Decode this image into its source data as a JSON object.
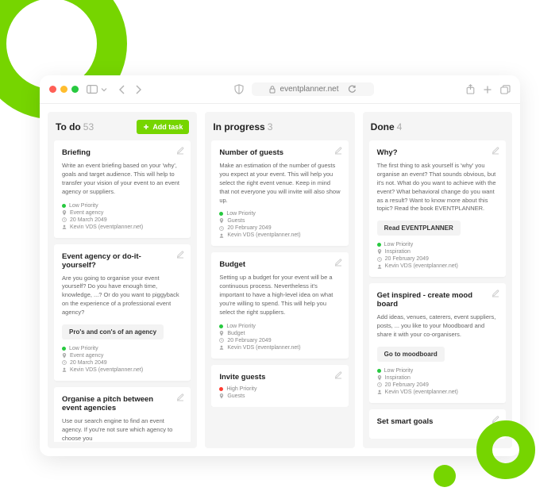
{
  "browser": {
    "url": "eventplanner.net"
  },
  "addTaskLabel": "Add task",
  "columns": [
    {
      "title": "To do",
      "count": 53,
      "showAdd": true,
      "cards": [
        {
          "title": "Briefing",
          "desc": "Write an event briefing based on your 'why', goals and target audience. This will help to transfer your vision of your event to an event agency or suppliers.",
          "priority": "Low Priority",
          "priClass": "pri-low",
          "category": "Event agency",
          "date": "20 March 2049",
          "assignee": "Kevin VDS (eventplanner.net)"
        },
        {
          "title": "Event agency or do-it-yourself?",
          "desc": "Are you going to organise your event yourself? Do you have enough time, knowledge, ...? Or do you want to piggyback on the experience of a professional event agency?",
          "button": "Pro's and con's of an agency",
          "priority": "Low Priority",
          "priClass": "pri-low",
          "category": "Event agency",
          "date": "20 March 2049",
          "assignee": "Kevin VDS (eventplanner.net)"
        },
        {
          "title": "Organise a pitch between event agencies",
          "desc": "Use our search engine to find an event agency. If you're not sure which agency to choose you"
        }
      ]
    },
    {
      "title": "In progress",
      "count": 3,
      "cards": [
        {
          "title": "Number of guests",
          "desc": "Make an estimation of the number of guests you expect at your event. This will help you select the right event venue. Keep in mind that not everyone you will invite will also show up.",
          "priority": "Low Priority",
          "priClass": "pri-low",
          "category": "Guests",
          "date": "20 February 2049",
          "assignee": "Kevin VDS (eventplanner.net)"
        },
        {
          "title": "Budget",
          "desc": "Setting up a budget for your event will be a continuous process. Nevertheless it's important to have a high-level idea on what you're willing to spend. This will help you select the right suppliers.",
          "priority": "Low Priority",
          "priClass": "pri-low",
          "category": "Budget",
          "date": "20 February 2049",
          "assignee": "Kevin VDS (eventplanner.net)"
        },
        {
          "title": "Invite guests",
          "priority": "High Priority",
          "priClass": "pri-high",
          "category": "Guests"
        }
      ]
    },
    {
      "title": "Done",
      "count": 4,
      "cards": [
        {
          "title": "Why?",
          "desc": "The first thing to ask yourself is 'why' you organise an event? That sounds obvious, but it's not. What do you want to achieve with the event? What behavioral change do you want as a result? Want to know more about this topic? Read the book EVENTPLANNER.",
          "button": "Read EVENTPLANNER",
          "priority": "Low Priority",
          "priClass": "pri-low",
          "category": "Inspiration",
          "date": "20 February 2049",
          "assignee": "Kevin VDS (eventplanner.net)"
        },
        {
          "title": "Get inspired - create mood board",
          "desc": "Add ideas, venues, caterers, event suppliers, posts, ... you like to your Moodboard and share it with your co-organisers.",
          "button": "Go to moodboard",
          "priority": "Low Priority",
          "priClass": "pri-low",
          "category": "Inspiration",
          "date": "20 February 2049",
          "assignee": "Kevin VDS (eventplanner.net)"
        },
        {
          "title": "Set smart goals"
        }
      ]
    }
  ]
}
